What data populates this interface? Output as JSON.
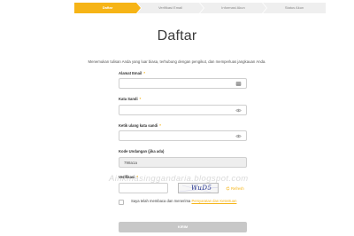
{
  "stepper": {
    "steps": [
      {
        "label": "Daftar",
        "active": true
      },
      {
        "label": "Verifikasi Email",
        "active": false
      },
      {
        "label": "Informasi Akun",
        "active": false
      },
      {
        "label": "Status Akun",
        "active": false
      }
    ]
  },
  "colors": {
    "accent": "#f6b416",
    "button_disabled": "#c8c8c8"
  },
  "heading": {
    "title": "Daftar",
    "subtitle": "Menemukan tulisan Anda yang luar biasa, terhubung dengan pengikut, dan memperluas jangkauan Anda."
  },
  "form": {
    "email": {
      "label": "Alamat Email",
      "required_mark": "*",
      "value": "",
      "icon": "card-icon"
    },
    "password": {
      "label": "Kata Sandi",
      "required_mark": "*",
      "value": "",
      "icon": "eye-icon"
    },
    "password_confirm": {
      "label": "Ketik ulang kata sandi",
      "required_mark": "*",
      "value": "",
      "icon": "eye-icon"
    },
    "invite_code": {
      "label": "Kode Undangan (jika ada)",
      "value": "798a1a"
    },
    "verification": {
      "label": "Verifikasi",
      "required_mark": "*",
      "value": "",
      "captcha_text": "WuD5",
      "refresh_label": "Refresh",
      "refresh_icon": "refresh-icon"
    },
    "agreement": {
      "text": "Saya telah membaca dan menerima ",
      "link": "Persyaratan dan Ketentuan"
    },
    "submit_label": "KIRIM"
  },
  "watermark": "Ainkmasinggandaria.blogspot.com"
}
